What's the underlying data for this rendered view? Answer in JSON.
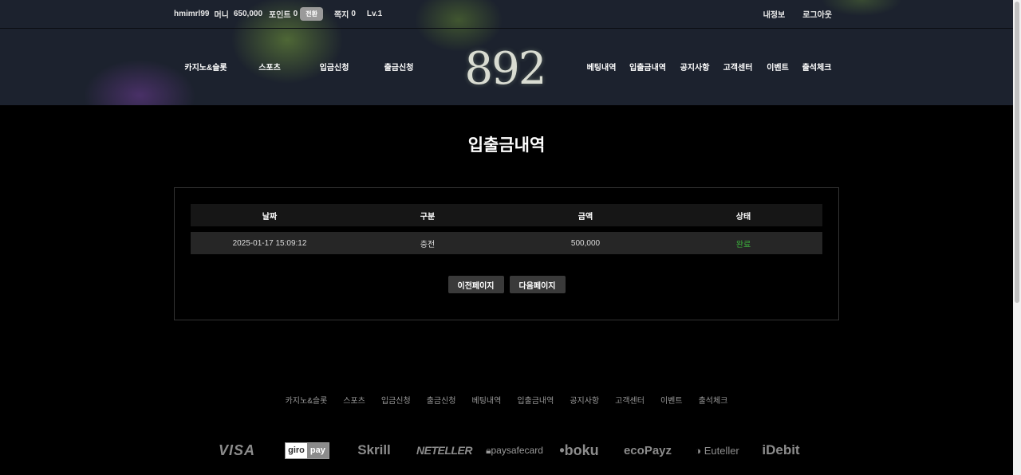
{
  "topbar": {
    "username": "hmimrl99",
    "money_label": "머니",
    "money_value": "650,000",
    "point_label": "포인트",
    "point_value": "0",
    "convert_label": "전환",
    "message_label": "쪽지",
    "message_value": "0",
    "level": "Lv.1",
    "my_info": "내정보",
    "logout": "로그아웃"
  },
  "logo_text": "892",
  "nav": {
    "left": [
      "카지노&슬롯",
      "스포츠",
      "입금신청",
      "출금신청"
    ],
    "right": [
      "베팅내역",
      "입출금내역",
      "공지사항",
      "고객센터",
      "이벤트",
      "출석체크"
    ]
  },
  "page_title": "입출금내역",
  "table": {
    "headers": [
      "날짜",
      "구분",
      "금액",
      "상태"
    ],
    "rows": [
      {
        "date": "2025-01-17 15:09:12",
        "type": "충전",
        "amount": "500,000",
        "status": "완료"
      }
    ]
  },
  "pager": {
    "prev": "이전페이지",
    "next": "다음페이지"
  },
  "footer_nav": [
    "카지노&슬롯",
    "스포츠",
    "입금신청",
    "출금신청",
    "베팅내역",
    "입출금내역",
    "공지사항",
    "고객센터",
    "이벤트",
    "출석체크"
  ],
  "payments": {
    "visa": "VISA",
    "giro_1": "giro",
    "giro_2": "pay",
    "skrill": "Skrill",
    "neteller": "NETELLER",
    "paysafe": "paysafecard",
    "boku": "•boku",
    "ecopayz": "ecoPayz",
    "euteller": "Euteller",
    "idebit": "iDebit"
  },
  "colors": {
    "header_bg": "#1c222e",
    "status_ok": "#3db43d",
    "button_bg": "#3a3a3a"
  }
}
